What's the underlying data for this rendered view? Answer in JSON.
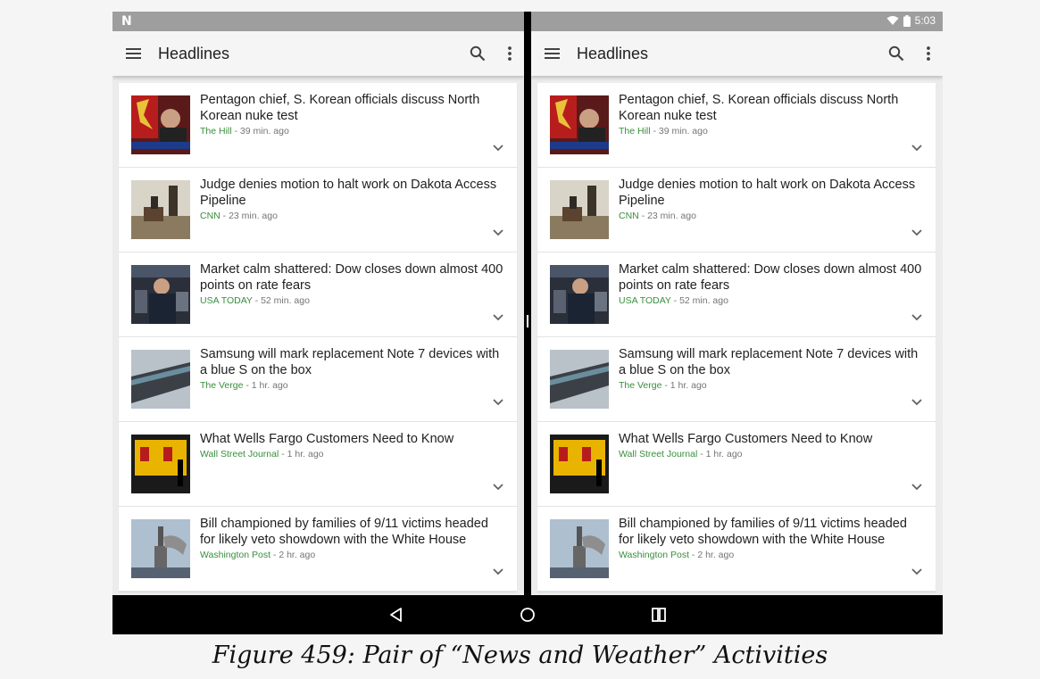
{
  "status": {
    "brand": "N",
    "time": "5:03"
  },
  "left": {
    "title": "Headlines",
    "items": [
      {
        "headline": "Pentagon chief, S. Korean officials discuss North Korean nuke test",
        "source": "The Hill",
        "age": " - 39 min. ago"
      },
      {
        "headline": "Judge denies motion to halt work on Dakota Access Pipeline",
        "source": "CNN",
        "age": " - 23 min. ago"
      },
      {
        "headline": "Market calm shattered: Dow closes down almost 400 points on rate fears",
        "source": "USA TODAY",
        "age": " - 52 min. ago"
      },
      {
        "headline": "Samsung will mark replacement Note 7 devices with a blue S on the box",
        "source": "The Verge",
        "age": " - 1 hr. ago"
      },
      {
        "headline": "What Wells Fargo Customers Need to Know",
        "source": "Wall Street Journal",
        "age": " - 1 hr. ago"
      },
      {
        "headline": "Bill championed by families of 9/11 victims headed for likely veto showdown with the White House",
        "source": "Washington Post",
        "age": " - 2 hr. ago"
      }
    ]
  },
  "right": {
    "title": "Headlines",
    "items": [
      {
        "headline": "Pentagon chief, S. Korean officials discuss North Korean nuke test",
        "source": "The Hill",
        "age": " - 39 min. ago"
      },
      {
        "headline": "Judge denies motion to halt work on Dakota Access Pipeline",
        "source": "CNN",
        "age": " - 23 min. ago"
      },
      {
        "headline": "Market calm shattered: Dow closes down almost 400 points on rate fears",
        "source": "USA TODAY",
        "age": " - 52 min. ago"
      },
      {
        "headline": "Samsung will mark replacement Note 7 devices with a blue S on the box",
        "source": "The Verge",
        "age": " - 1 hr. ago"
      },
      {
        "headline": "What Wells Fargo Customers Need to Know",
        "source": "Wall Street Journal",
        "age": " - 1 hr. ago"
      },
      {
        "headline": "Bill championed by families of 9/11 victims headed for likely veto showdown with the White House",
        "source": "Washington Post",
        "age": " - 2 hr. ago"
      }
    ]
  },
  "caption": "Figure 459: Pair of “News and Weather” Activities",
  "colors": {
    "source": "#388e3c",
    "statusbar": "#9e9e9e",
    "appbar": "#f5f5f5"
  },
  "icons": [
    "menu-icon",
    "search-icon",
    "overflow-menu-icon",
    "chevron-down-icon",
    "wifi-icon",
    "battery-icon",
    "back-icon",
    "home-icon",
    "recents-icon"
  ]
}
